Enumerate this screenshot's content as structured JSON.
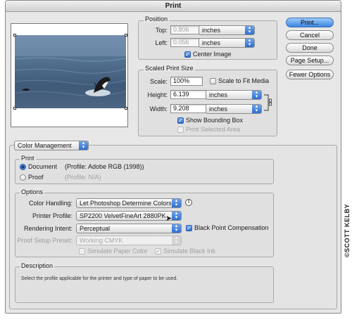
{
  "window": {
    "title": "Print"
  },
  "position": {
    "group_label": "Position",
    "top_label": "Top:",
    "top_value": "0.806",
    "top_unit": "inches",
    "left_label": "Left:",
    "left_value": "0.056",
    "left_unit": "inches",
    "center_image_label": "Center Image",
    "center_image_checked": true
  },
  "scaled_print_size": {
    "group_label": "Scaled Print Size",
    "scale_label": "Scale:",
    "scale_value": "100%",
    "scale_to_fit_label": "Scale to Fit Media",
    "scale_to_fit_checked": false,
    "height_label": "Height:",
    "height_value": "6.139",
    "height_unit": "inches",
    "width_label": "Width:",
    "width_value": "9.208",
    "width_unit": "inches",
    "show_bounding_box_label": "Show Bounding Box",
    "show_bounding_box_checked": true,
    "print_selected_area_label": "Print Selected Area",
    "print_selected_area_checked": false
  },
  "buttons": {
    "print": "Print...",
    "cancel": "Cancel",
    "done": "Done",
    "page_setup": "Page Setup...",
    "fewer_options": "Fewer Options"
  },
  "color_management": {
    "menu_value": "Color Management",
    "print_group_label": "Print",
    "document_label": "Document",
    "document_profile": "(Profile: Adobe RGB (1998))",
    "proof_label": "Proof",
    "proof_profile": "(Profile: N/A)",
    "selected": "Document",
    "options_group_label": "Options",
    "color_handling_label": "Color Handling:",
    "color_handling_value": "Let Photoshop Determine Colors",
    "printer_profile_label": "Printer Profile:",
    "printer_profile_value": "SP2200 VelvetFineArt 2880PK",
    "rendering_intent_label": "Rendering Intent:",
    "rendering_intent_value": "Perceptual",
    "black_point_label": "Black Point Compensation",
    "black_point_checked": true,
    "proof_setup_label": "Proof Setup Preset:",
    "proof_setup_value": "Working CMYK",
    "simulate_paper_label": "Simulate Paper Color",
    "simulate_ink_label": "Simulate Black Ink",
    "simulate_ink_checked": true
  },
  "description": {
    "group_label": "Description",
    "text": "Select the profile applicable for the printer and type of paper to be used."
  },
  "watermark": "©SCOTT KELBY",
  "icons": [
    "link-chain-icon",
    "info-icon",
    "checkmark-icon",
    "popup-arrows-icon",
    "cursor-arrow-icon"
  ],
  "colors": {
    "accent": "#3b86e0",
    "window_bg": "#e7e7e7"
  }
}
